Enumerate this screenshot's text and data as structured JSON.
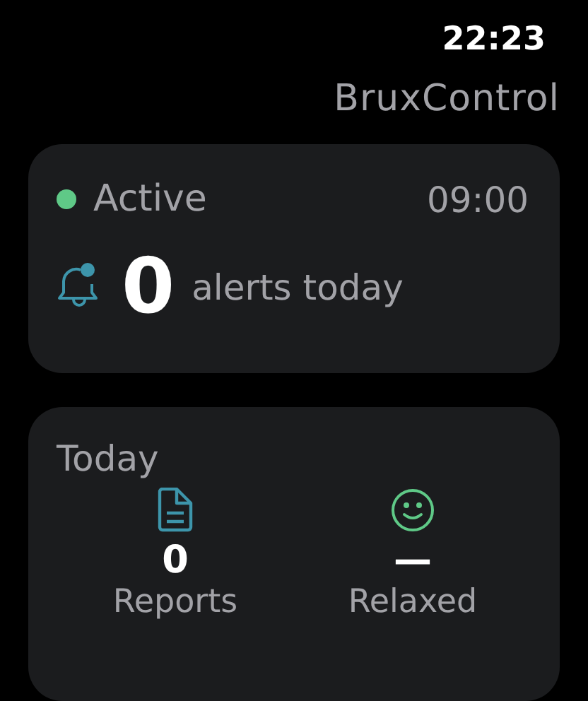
{
  "status_bar": {
    "time": "22:23"
  },
  "app_title": "BruxControl",
  "status_card": {
    "status": "Active",
    "on": true,
    "time": "09:00",
    "alert_count": "0",
    "alert_label": "alerts today"
  },
  "today_card": {
    "title": "Today",
    "stats": [
      {
        "kind": "document",
        "value": "0",
        "label": "Reports"
      },
      {
        "kind": "smiley",
        "value": "—",
        "label": "Relaxed"
      }
    ]
  }
}
